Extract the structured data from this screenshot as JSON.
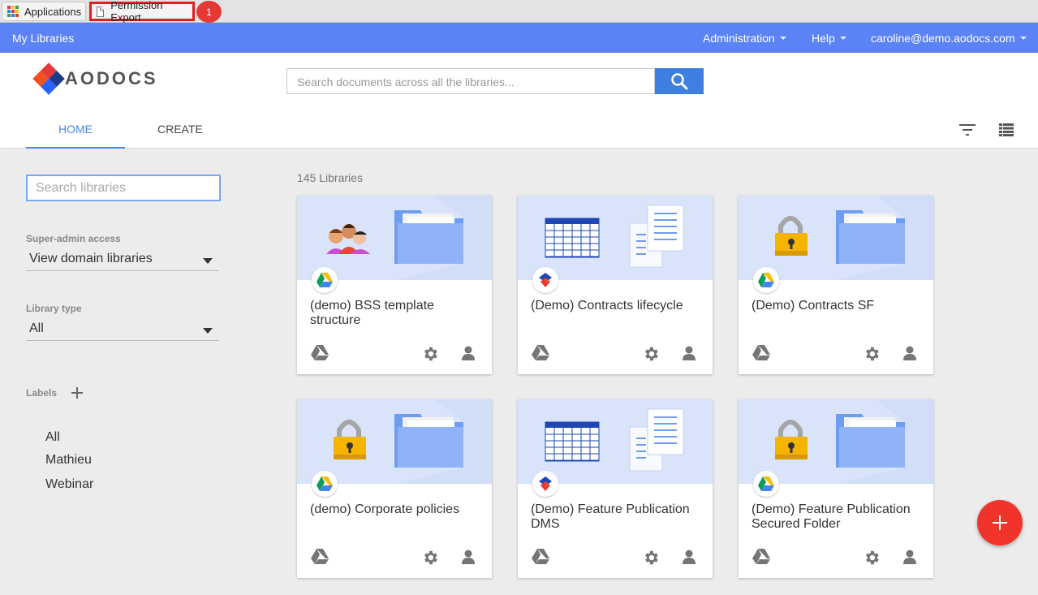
{
  "bookmarks": {
    "apps_label": "Applications",
    "tab_label": "Permission Export",
    "badge": "1"
  },
  "appbar": {
    "title": "My Libraries",
    "administration": "Administration",
    "help": "Help",
    "user": "caroline@demo.aodocs.com"
  },
  "header": {
    "logo_text": "AODOCS",
    "search_placeholder": "Search documents across all the libraries...",
    "tabs": [
      "HOME",
      "CREATE"
    ]
  },
  "sidebar": {
    "search_placeholder": "Search libraries",
    "superadmin_label": "Super-admin access",
    "superadmin_value": "View domain libraries",
    "libtype_label": "Library type",
    "libtype_value": "All",
    "labels_heading": "Labels",
    "labels": [
      "All",
      "Mathieu",
      "Webinar"
    ]
  },
  "main": {
    "count": "145 Libraries",
    "cards": [
      {
        "title": "(demo) BSS template structure",
        "art": "people",
        "badge": "drive"
      },
      {
        "title": "(Demo) Contracts lifecycle",
        "art": "table",
        "badge": "aodocs"
      },
      {
        "title": "(Demo) Contracts SF",
        "art": "lock",
        "badge": "drive"
      },
      {
        "title": "(demo) Corporate policies",
        "art": "lock",
        "badge": "drive"
      },
      {
        "title": "(Demo) Feature Publication DMS",
        "art": "table",
        "badge": "aodocs"
      },
      {
        "title": "(Demo) Feature Publication Secured Folder",
        "art": "lock",
        "badge": "drive"
      }
    ]
  },
  "colors": {
    "appbar": "#5b83f5",
    "accent": "#4a86e8",
    "fab": "#f0342c",
    "banner": "#d9e4fb"
  },
  "icons": {
    "search": "search-icon",
    "filter": "filter-icon",
    "list": "list-view-icon",
    "add": "plus-icon",
    "drive": "google-drive-icon",
    "settings": "gear-icon",
    "members": "user-icon"
  }
}
